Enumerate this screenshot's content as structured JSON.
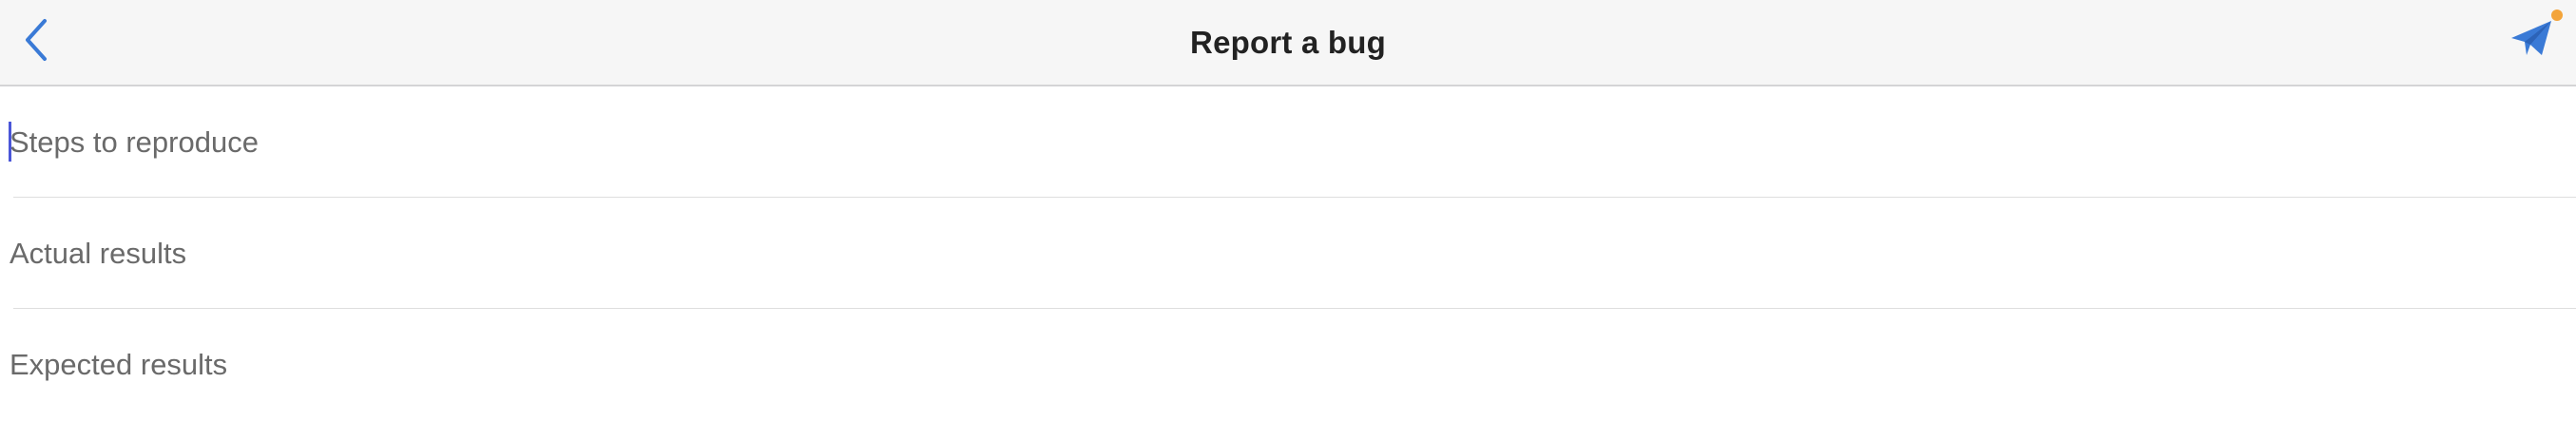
{
  "navbar": {
    "title": "Report a bug",
    "back_icon": "chevron-left-icon",
    "send_icon": "paper-plane-icon",
    "accent_color": "#3a7ad6",
    "notification_dot_color": "#f3a43a"
  },
  "fields": [
    {
      "placeholder": "Steps to reproduce",
      "value": ""
    },
    {
      "placeholder": "Actual results",
      "value": ""
    },
    {
      "placeholder": "Expected results",
      "value": ""
    }
  ],
  "caret_color": "#4a56d8"
}
